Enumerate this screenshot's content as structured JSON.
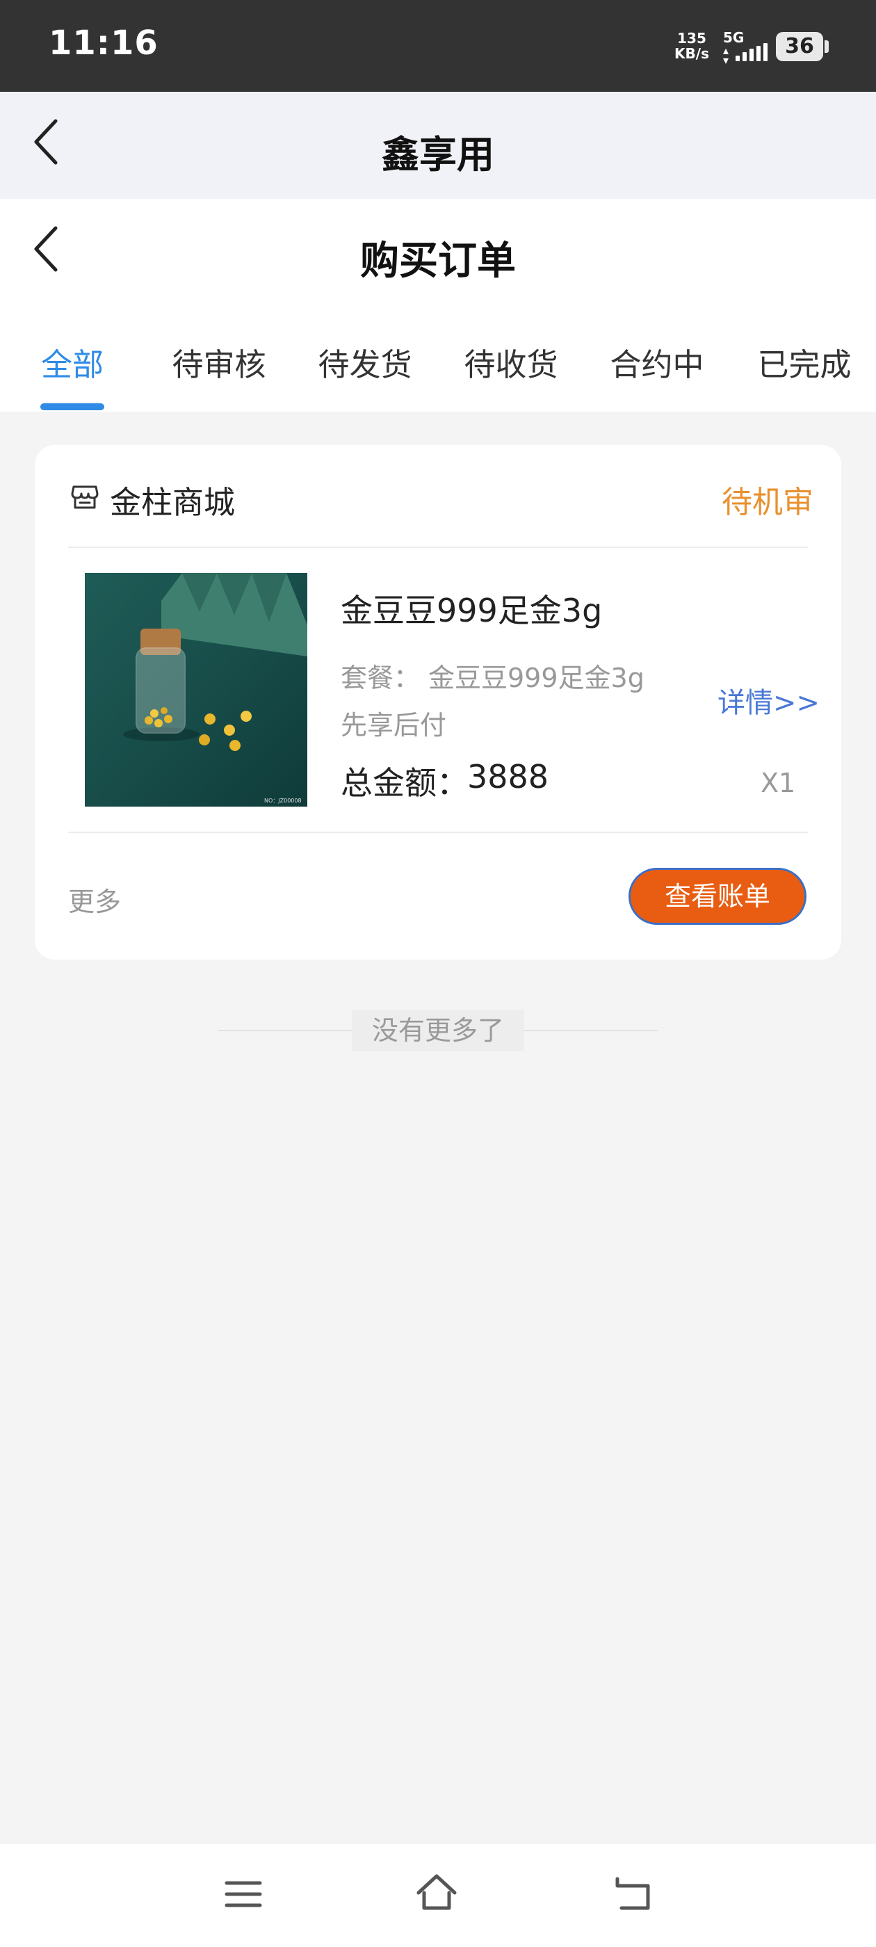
{
  "status_bar": {
    "time": "11:16",
    "net_speed_value": "135",
    "net_speed_unit": "KB/s",
    "network": "5G",
    "battery": "36"
  },
  "outer_header": {
    "title": "鑫享用"
  },
  "inner_header": {
    "title": "购买订单"
  },
  "tabs": [
    {
      "label": "全部",
      "active": true
    },
    {
      "label": "待审核"
    },
    {
      "label": "待发货"
    },
    {
      "label": "待收货"
    },
    {
      "label": "合约中"
    },
    {
      "label": "已完成"
    }
  ],
  "order": {
    "store_name": "金柱商城",
    "status": "待机审",
    "product_name": "金豆豆999足金3g",
    "package_label": "套餐：",
    "package_value": "金豆豆999足金3g",
    "payment_mode": "先享后付",
    "total_label": "总金额：",
    "total_value": "3888",
    "detail_link": "详情>>",
    "quantity": "X1",
    "more_label": "更多",
    "bill_button": "查看账单",
    "image_caption": "NO：JZ00008"
  },
  "list_end_text": "没有更多了",
  "icons": {
    "back": "chevron-left-icon",
    "store": "store-icon",
    "nav_menu": "menu-icon",
    "nav_home": "home-icon",
    "nav_back": "return-icon"
  },
  "colors": {
    "accent_blue": "#2f8be6",
    "status_orange": "#e8902e",
    "button_orange": "#e85d11",
    "link_blue": "#4a78d6"
  }
}
